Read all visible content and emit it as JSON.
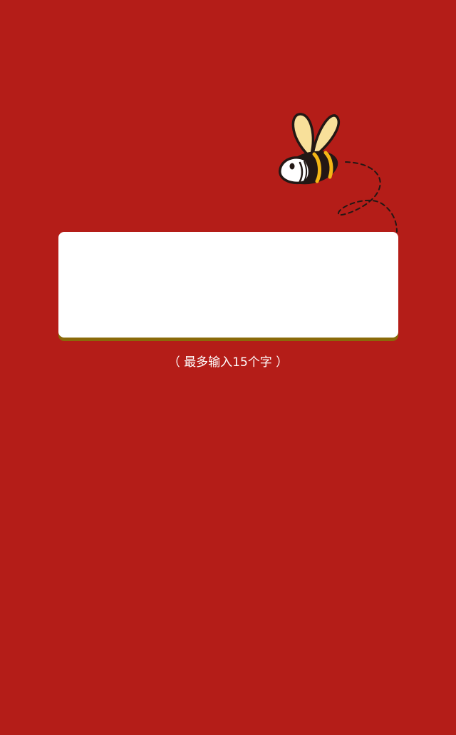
{
  "colors": {
    "background": "#b41d18",
    "input_background": "#ffffff",
    "input_shadow": "#8a6a0a",
    "hint_text": "#ffffff",
    "bee_wing": "#f8e09a",
    "bee_stripe": "#f5b716",
    "bee_outline": "#231815"
  },
  "decoration": {
    "icon": "bee-icon"
  },
  "input": {
    "value": "",
    "placeholder": ""
  },
  "hint": {
    "text": "（ 最多输入15个字 ）"
  }
}
